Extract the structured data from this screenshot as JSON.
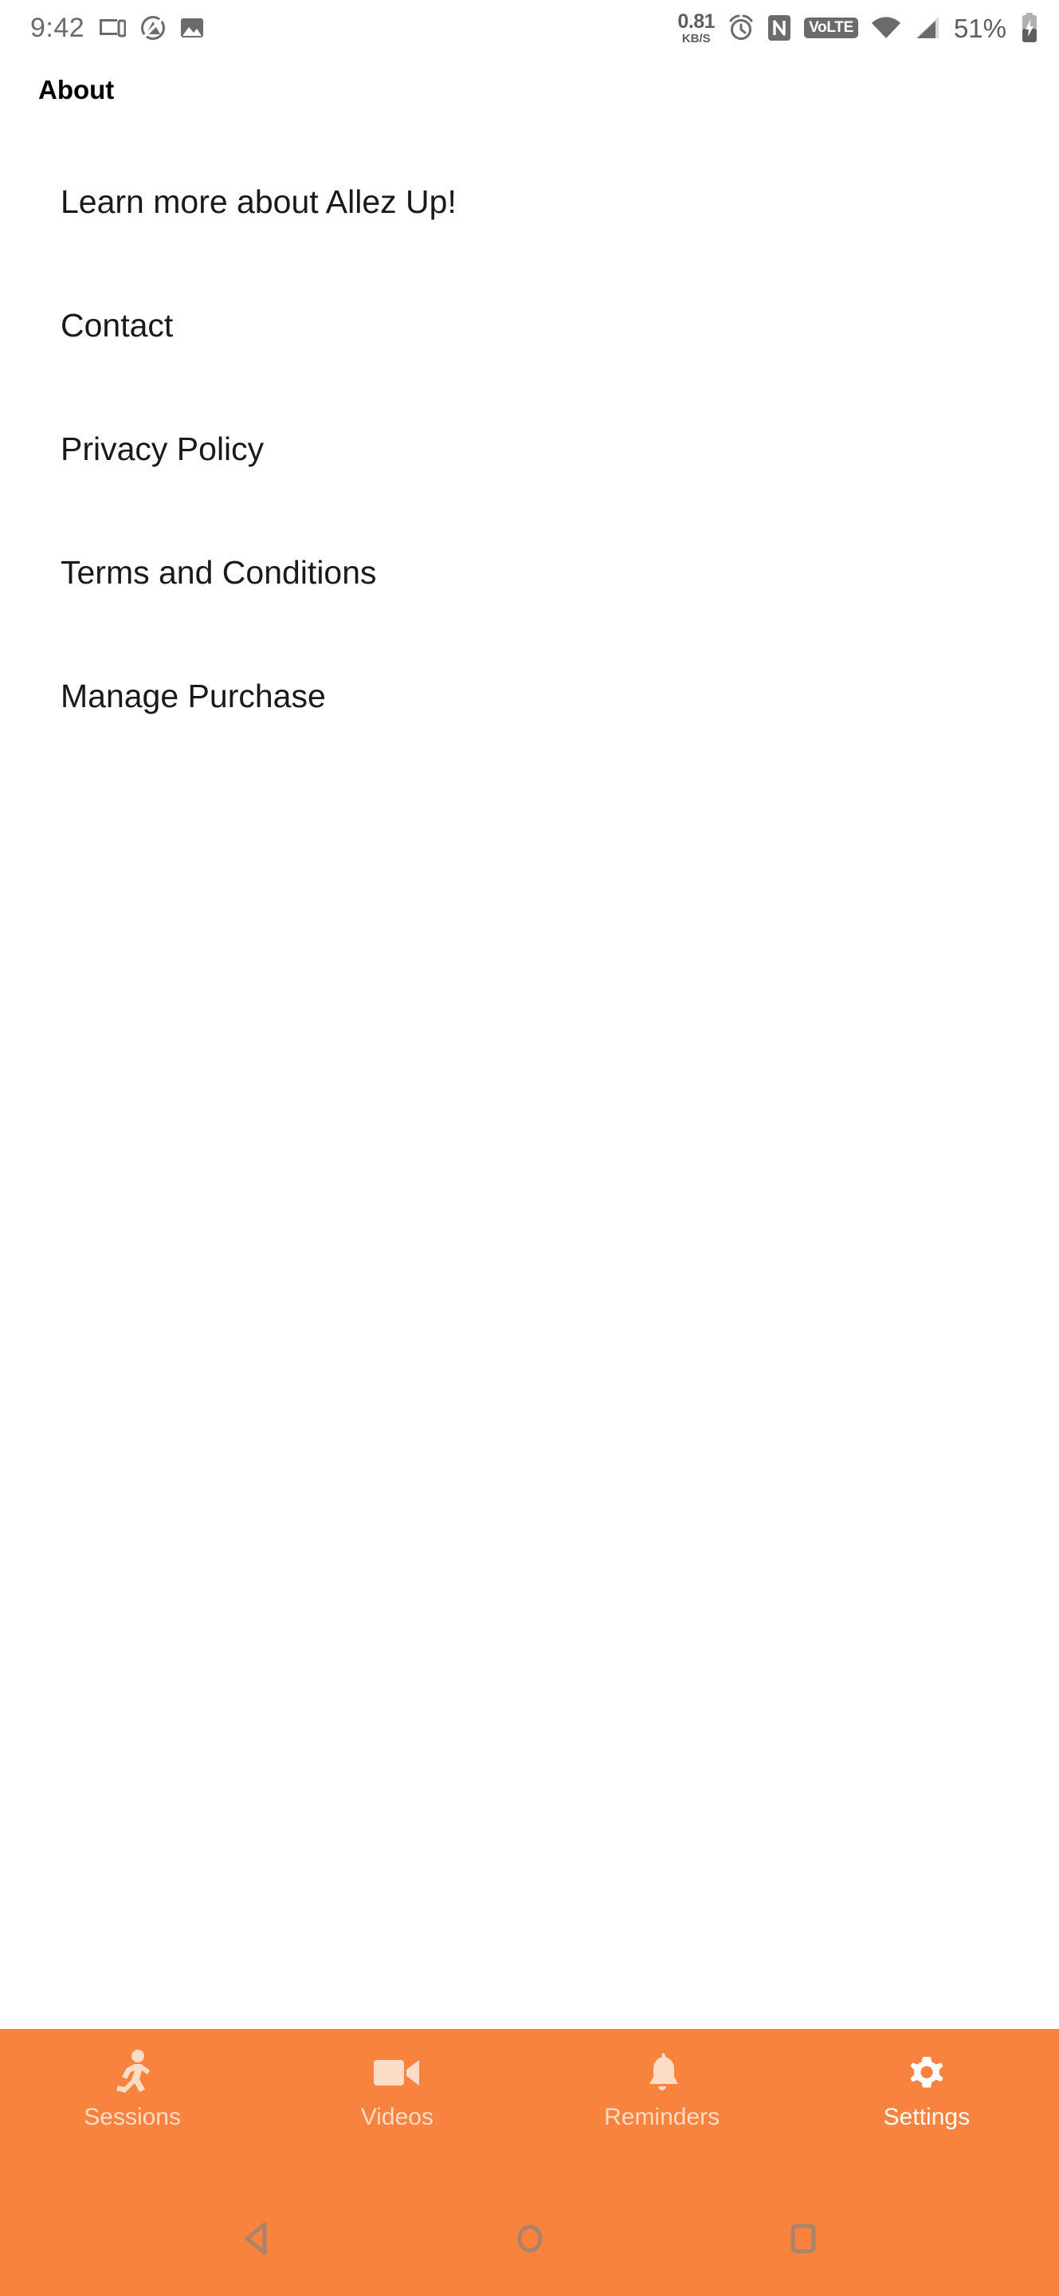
{
  "status_bar": {
    "time": "9:42",
    "network_speed_value": "0.81",
    "network_speed_unit": "KB/S",
    "volte_label": "VoLTE",
    "battery_percent": "51%",
    "icons_left": [
      "cast-screen-icon",
      "do-not-disturb-icon",
      "image-icon"
    ],
    "icons_right": [
      "alarm-icon",
      "nfc-icon",
      "volte-icon",
      "wifi-icon",
      "cellular-signal-icon",
      "battery-charging-icon"
    ]
  },
  "header": {
    "title": "About"
  },
  "menu": {
    "items": [
      {
        "label": "Learn more about Allez Up!",
        "name": "menu-item-learn-more"
      },
      {
        "label": "Contact",
        "name": "menu-item-contact"
      },
      {
        "label": "Privacy Policy",
        "name": "menu-item-privacy-policy"
      },
      {
        "label": "Terms and Conditions",
        "name": "menu-item-terms-and-conditions"
      },
      {
        "label": "Manage Purchase",
        "name": "menu-item-manage-purchase"
      }
    ]
  },
  "tab_bar": {
    "accent_color": "#F8833F",
    "active_color": "#FFFFFF",
    "inactive_color": "#FBDCC6",
    "tabs": [
      {
        "label": "Sessions",
        "icon": "running-person-icon",
        "active": false
      },
      {
        "label": "Videos",
        "icon": "video-camera-icon",
        "active": false
      },
      {
        "label": "Reminders",
        "icon": "bell-icon",
        "active": false
      },
      {
        "label": "Settings",
        "icon": "gear-icon",
        "active": true
      }
    ]
  },
  "nav_bar": {
    "back": "back-triangle-icon",
    "home": "home-circle-icon",
    "recents": "recents-square-icon"
  }
}
